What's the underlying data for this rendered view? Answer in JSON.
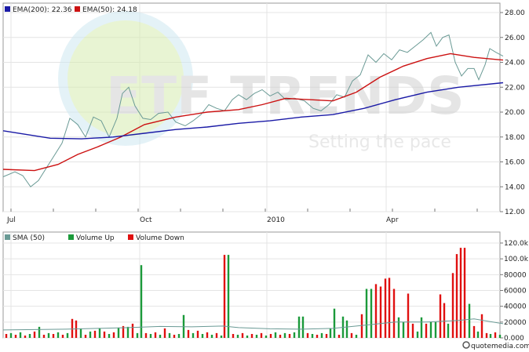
{
  "chart_data": [
    {
      "type": "line",
      "legend": [
        {
          "label": "EMA(200): 22.36",
          "color": "#1a1aa6"
        },
        {
          "label": "EMA(50): 24.18",
          "color": "#cc1111"
        }
      ],
      "x_ticks": [
        "Jul",
        "Oct",
        "2010",
        "Apr"
      ],
      "y_ticks": [
        "12.00",
        "14.00",
        "16.00",
        "18.00",
        "20.00",
        "22.00",
        "24.00",
        "26.00",
        "28.00"
      ],
      "ylim": [
        12,
        28
      ],
      "grid": true,
      "watermark": {
        "title": "ETF TRENDS",
        "subtitle": "Setting the pace"
      },
      "series": [
        {
          "name": "EMA(200)",
          "color": "#1a1aa6",
          "points": [
            [
              0,
              18.5
            ],
            [
              30,
              18.2
            ],
            [
              60,
              17.9
            ],
            [
              100,
              17.85
            ],
            [
              140,
              18.0
            ],
            [
              180,
              18.3
            ],
            [
              220,
              18.6
            ],
            [
              260,
              18.8
            ],
            [
              300,
              19.1
            ],
            [
              340,
              19.3
            ],
            [
              380,
              19.6
            ],
            [
              420,
              19.8
            ],
            [
              460,
              20.3
            ],
            [
              500,
              21.0
            ],
            [
              540,
              21.6
            ],
            [
              580,
              22.0
            ],
            [
              637,
              22.36
            ]
          ]
        },
        {
          "name": "EMA(50)",
          "color": "#cc1111",
          "points": [
            [
              0,
              15.4
            ],
            [
              40,
              15.3
            ],
            [
              70,
              15.8
            ],
            [
              95,
              16.6
            ],
            [
              120,
              17.2
            ],
            [
              150,
              18.0
            ],
            [
              180,
              19.0
            ],
            [
              220,
              19.6
            ],
            [
              260,
              20.0
            ],
            [
              300,
              20.2
            ],
            [
              330,
              20.6
            ],
            [
              360,
              21.1
            ],
            [
              390,
              21.0
            ],
            [
              420,
              20.9
            ],
            [
              450,
              21.6
            ],
            [
              480,
              22.8
            ],
            [
              510,
              23.7
            ],
            [
              540,
              24.3
            ],
            [
              570,
              24.7
            ],
            [
              600,
              24.4
            ],
            [
              637,
              24.18
            ]
          ]
        },
        {
          "name": "Price",
          "color": "#6a9a95",
          "points": [
            [
              0,
              14.8
            ],
            [
              15,
              15.2
            ],
            [
              25,
              14.9
            ],
            [
              35,
              14.0
            ],
            [
              45,
              14.5
            ],
            [
              55,
              15.5
            ],
            [
              65,
              16.5
            ],
            [
              75,
              17.5
            ],
            [
              85,
              19.5
            ],
            [
              95,
              19.0
            ],
            [
              105,
              18.0
            ],
            [
              115,
              19.6
            ],
            [
              125,
              19.3
            ],
            [
              135,
              18.0
            ],
            [
              145,
              19.5
            ],
            [
              152,
              21.5
            ],
            [
              160,
              22.0
            ],
            [
              168,
              20.5
            ],
            [
              178,
              19.5
            ],
            [
              188,
              19.4
            ],
            [
              198,
              19.9
            ],
            [
              210,
              20.0
            ],
            [
              220,
              19.2
            ],
            [
              232,
              18.9
            ],
            [
              242,
              19.3
            ],
            [
              252,
              19.8
            ],
            [
              262,
              20.6
            ],
            [
              272,
              20.3
            ],
            [
              282,
              20.1
            ],
            [
              292,
              21.0
            ],
            [
              300,
              21.4
            ],
            [
              310,
              21.0
            ],
            [
              320,
              21.5
            ],
            [
              330,
              21.8
            ],
            [
              340,
              21.3
            ],
            [
              350,
              21.6
            ],
            [
              360,
              21.0
            ],
            [
              372,
              21.1
            ],
            [
              384,
              20.9
            ],
            [
              395,
              20.3
            ],
            [
              405,
              20.1
            ],
            [
              415,
              20.6
            ],
            [
              425,
              21.4
            ],
            [
              435,
              21.2
            ],
            [
              445,
              22.5
            ],
            [
              455,
              23.0
            ],
            [
              465,
              24.6
            ],
            [
              475,
              24.0
            ],
            [
              485,
              24.7
            ],
            [
              495,
              24.2
            ],
            [
              505,
              25.0
            ],
            [
              515,
              24.8
            ],
            [
              525,
              25.3
            ],
            [
              535,
              25.8
            ],
            [
              545,
              26.4
            ],
            [
              552,
              25.3
            ],
            [
              560,
              26.0
            ],
            [
              568,
              26.2
            ],
            [
              576,
              24.0
            ],
            [
              584,
              22.9
            ],
            [
              592,
              23.5
            ],
            [
              600,
              23.5
            ],
            [
              606,
              22.6
            ],
            [
              614,
              23.8
            ],
            [
              620,
              25.1
            ],
            [
              628,
              24.8
            ],
            [
              637,
              24.5
            ]
          ]
        }
      ]
    },
    {
      "type": "bar",
      "legend": [
        {
          "label": "SMA (50)",
          "color": "#6a9a95"
        },
        {
          "label": "Volume Up",
          "color": "#1b9a3a"
        },
        {
          "label": "Volume Down",
          "color": "#e01010"
        }
      ],
      "y_ticks": [
        "0.000",
        "20000",
        "40000",
        "60000",
        "80000",
        "100.0k",
        "120.0k"
      ],
      "ylim": [
        0,
        120000
      ],
      "grid": true,
      "bars": [
        {
          "x": 4,
          "v": 5000,
          "up": false
        },
        {
          "x": 10,
          "v": 6000,
          "up": true
        },
        {
          "x": 16,
          "v": 4000,
          "up": false
        },
        {
          "x": 22,
          "v": 7000,
          "up": true
        },
        {
          "x": 28,
          "v": 3000,
          "up": false
        },
        {
          "x": 34,
          "v": 5000,
          "up": true
        },
        {
          "x": 40,
          "v": 8000,
          "up": false
        },
        {
          "x": 46,
          "v": 14000,
          "up": true
        },
        {
          "x": 52,
          "v": 4000,
          "up": false
        },
        {
          "x": 58,
          "v": 6000,
          "up": true
        },
        {
          "x": 64,
          "v": 5000,
          "up": false
        },
        {
          "x": 70,
          "v": 7000,
          "up": true
        },
        {
          "x": 76,
          "v": 4000,
          "up": false
        },
        {
          "x": 82,
          "v": 6000,
          "up": true
        },
        {
          "x": 88,
          "v": 24000,
          "up": false
        },
        {
          "x": 93,
          "v": 22000,
          "up": false
        },
        {
          "x": 99,
          "v": 12000,
          "up": true
        },
        {
          "x": 105,
          "v": 4000,
          "up": false
        },
        {
          "x": 111,
          "v": 8000,
          "up": true
        },
        {
          "x": 117,
          "v": 9000,
          "up": false
        },
        {
          "x": 123,
          "v": 12000,
          "up": true
        },
        {
          "x": 129,
          "v": 8000,
          "up": false
        },
        {
          "x": 135,
          "v": 5000,
          "up": true
        },
        {
          "x": 141,
          "v": 7000,
          "up": false
        },
        {
          "x": 147,
          "v": 13000,
          "up": true
        },
        {
          "x": 153,
          "v": 15000,
          "up": false
        },
        {
          "x": 159,
          "v": 14000,
          "up": true
        },
        {
          "x": 165,
          "v": 18000,
          "up": false
        },
        {
          "x": 171,
          "v": 6000,
          "up": true
        },
        {
          "x": 176,
          "v": 92000,
          "up": true
        },
        {
          "x": 182,
          "v": 6000,
          "up": false
        },
        {
          "x": 188,
          "v": 5000,
          "up": true
        },
        {
          "x": 194,
          "v": 7000,
          "up": false
        },
        {
          "x": 200,
          "v": 4000,
          "up": true
        },
        {
          "x": 206,
          "v": 12000,
          "up": false
        },
        {
          "x": 212,
          "v": 6000,
          "up": true
        },
        {
          "x": 218,
          "v": 4000,
          "up": false
        },
        {
          "x": 224,
          "v": 5000,
          "up": true
        },
        {
          "x": 230,
          "v": 29000,
          "up": true
        },
        {
          "x": 236,
          "v": 10000,
          "up": false
        },
        {
          "x": 242,
          "v": 6000,
          "up": true
        },
        {
          "x": 248,
          "v": 9000,
          "up": false
        },
        {
          "x": 254,
          "v": 5000,
          "up": true
        },
        {
          "x": 260,
          "v": 7000,
          "up": false
        },
        {
          "x": 266,
          "v": 4000,
          "up": true
        },
        {
          "x": 272,
          "v": 6000,
          "up": false
        },
        {
          "x": 278,
          "v": 3000,
          "up": true
        },
        {
          "x": 282,
          "v": 105000,
          "up": false
        },
        {
          "x": 287,
          "v": 105000,
          "up": true
        },
        {
          "x": 293,
          "v": 5000,
          "up": false
        },
        {
          "x": 299,
          "v": 4000,
          "up": true
        },
        {
          "x": 305,
          "v": 6000,
          "up": false
        },
        {
          "x": 311,
          "v": 3000,
          "up": true
        },
        {
          "x": 317,
          "v": 5000,
          "up": false
        },
        {
          "x": 323,
          "v": 4000,
          "up": true
        },
        {
          "x": 329,
          "v": 6000,
          "up": false
        },
        {
          "x": 335,
          "v": 3000,
          "up": true
        },
        {
          "x": 341,
          "v": 5000,
          "up": false
        },
        {
          "x": 347,
          "v": 7000,
          "up": true
        },
        {
          "x": 353,
          "v": 4000,
          "up": false
        },
        {
          "x": 359,
          "v": 6000,
          "up": true
        },
        {
          "x": 365,
          "v": 5000,
          "up": false
        },
        {
          "x": 371,
          "v": 7000,
          "up": true
        },
        {
          "x": 377,
          "v": 27000,
          "up": true
        },
        {
          "x": 382,
          "v": 27000,
          "up": true
        },
        {
          "x": 388,
          "v": 6000,
          "up": false
        },
        {
          "x": 394,
          "v": 5000,
          "up": true
        },
        {
          "x": 400,
          "v": 4000,
          "up": false
        },
        {
          "x": 406,
          "v": 6000,
          "up": true
        },
        {
          "x": 412,
          "v": 5000,
          "up": false
        },
        {
          "x": 417,
          "v": 12000,
          "up": true
        },
        {
          "x": 422,
          "v": 37000,
          "up": true
        },
        {
          "x": 428,
          "v": 4000,
          "up": false
        },
        {
          "x": 433,
          "v": 27000,
          "up": true
        },
        {
          "x": 438,
          "v": 22000,
          "up": true
        },
        {
          "x": 444,
          "v": 6000,
          "up": false
        },
        {
          "x": 450,
          "v": 4000,
          "up": true
        },
        {
          "x": 457,
          "v": 30000,
          "up": false
        },
        {
          "x": 463,
          "v": 62000,
          "up": true
        },
        {
          "x": 469,
          "v": 62000,
          "up": true
        },
        {
          "x": 475,
          "v": 68000,
          "up": false
        },
        {
          "x": 481,
          "v": 65000,
          "up": false
        },
        {
          "x": 487,
          "v": 75000,
          "up": false
        },
        {
          "x": 492,
          "v": 76000,
          "up": false
        },
        {
          "x": 498,
          "v": 62000,
          "up": false
        },
        {
          "x": 504,
          "v": 26000,
          "up": true
        },
        {
          "x": 510,
          "v": 20000,
          "up": true
        },
        {
          "x": 516,
          "v": 56000,
          "up": false
        },
        {
          "x": 522,
          "v": 18000,
          "up": false
        },
        {
          "x": 528,
          "v": 8000,
          "up": true
        },
        {
          "x": 533,
          "v": 26000,
          "up": true
        },
        {
          "x": 539,
          "v": 18000,
          "up": false
        },
        {
          "x": 545,
          "v": 20000,
          "up": true
        },
        {
          "x": 551,
          "v": 20000,
          "up": true
        },
        {
          "x": 557,
          "v": 55000,
          "up": false
        },
        {
          "x": 562,
          "v": 44000,
          "up": false
        },
        {
          "x": 567,
          "v": 18000,
          "up": true
        },
        {
          "x": 573,
          "v": 82000,
          "up": false
        },
        {
          "x": 578,
          "v": 106000,
          "up": false
        },
        {
          "x": 583,
          "v": 114000,
          "up": false
        },
        {
          "x": 588,
          "v": 114000,
          "up": false
        },
        {
          "x": 594,
          "v": 43000,
          "up": true
        },
        {
          "x": 600,
          "v": 15000,
          "up": false
        },
        {
          "x": 605,
          "v": 8000,
          "up": true
        },
        {
          "x": 610,
          "v": 30000,
          "up": false
        },
        {
          "x": 616,
          "v": 6000,
          "up": false
        },
        {
          "x": 621,
          "v": 5000,
          "up": true
        },
        {
          "x": 627,
          "v": 7000,
          "up": false
        },
        {
          "x": 633,
          "v": 4000,
          "up": true
        }
      ],
      "sma_points": [
        [
          0,
          10000
        ],
        [
          40,
          10500
        ],
        [
          80,
          11000
        ],
        [
          120,
          12000
        ],
        [
          160,
          13000
        ],
        [
          200,
          14500
        ],
        [
          240,
          14000
        ],
        [
          280,
          15000
        ],
        [
          300,
          13000
        ],
        [
          340,
          11500
        ],
        [
          380,
          11000
        ],
        [
          420,
          12000
        ],
        [
          460,
          16000
        ],
        [
          500,
          20000
        ],
        [
          540,
          20000
        ],
        [
          580,
          22000
        ],
        [
          600,
          24000
        ],
        [
          637,
          18000
        ]
      ]
    }
  ],
  "footer": {
    "brand": "quotemedia.com"
  }
}
